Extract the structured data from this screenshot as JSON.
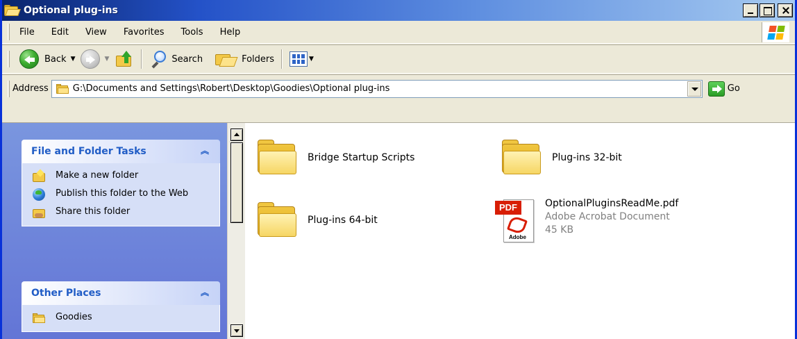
{
  "window": {
    "title": "Optional plug-ins"
  },
  "menu": [
    "File",
    "Edit",
    "View",
    "Favorites",
    "Tools",
    "Help"
  ],
  "toolbar": {
    "back_label": "Back",
    "search_label": "Search",
    "folders_label": "Folders"
  },
  "address": {
    "label": "Address",
    "path": "G:\\Documents and Settings\\Robert\\Desktop\\Goodies\\Optional plug-ins",
    "go_label": "Go"
  },
  "taskpane": {
    "file_tasks": {
      "title": "File and Folder Tasks",
      "items": [
        {
          "label": "Make a new folder",
          "icon": "new-folder-icon"
        },
        {
          "label": "Publish this folder to the Web",
          "icon": "publish-web-icon"
        },
        {
          "label": "Share this folder",
          "icon": "share-folder-icon"
        }
      ]
    },
    "other_places": {
      "title": "Other Places",
      "items": [
        {
          "label": "Goodies",
          "icon": "folder-icon"
        }
      ]
    }
  },
  "files": [
    {
      "name": "Bridge Startup Scripts",
      "type": "folder"
    },
    {
      "name": "Plug-ins 32-bit",
      "type": "folder"
    },
    {
      "name": "Plug-ins 64-bit",
      "type": "folder"
    },
    {
      "name": "OptionalPluginsReadMe.pdf",
      "type_label": "Adobe Acrobat Document",
      "size": "45 KB",
      "icon_text": "PDF",
      "brand": "Adobe"
    }
  ],
  "colors": {
    "titlebar": "#0a246a",
    "taskpane": "#6b85dc",
    "panel_title": "#215dc6",
    "pdf_red": "#d81e05"
  }
}
